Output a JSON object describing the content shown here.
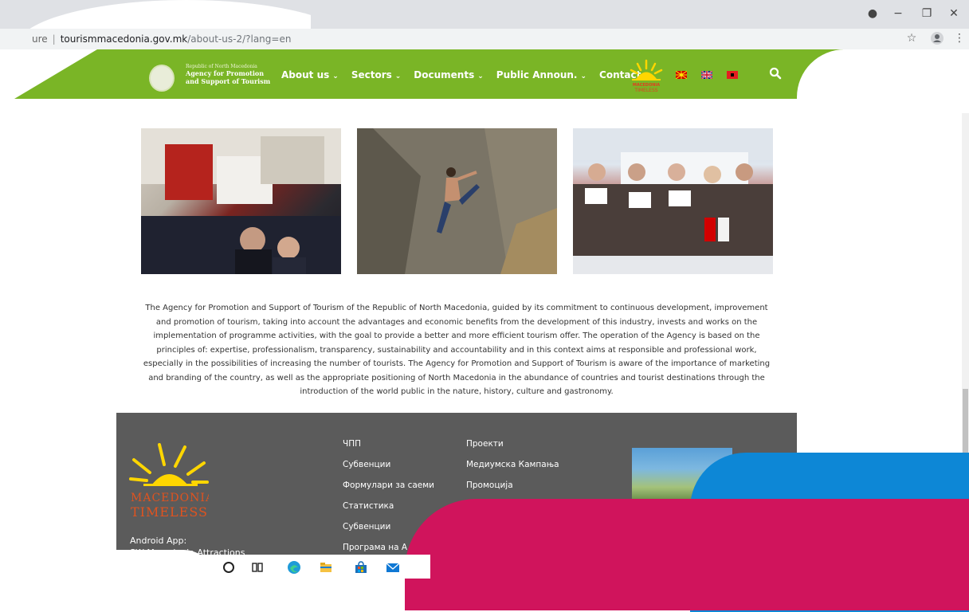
{
  "browser": {
    "url_prefix": "ure",
    "url_host": "tourismmacedonia.gov.mk",
    "url_path": "/about-us-2/?lang=en",
    "min_icon": "−",
    "restore_icon": "❐",
    "close_icon": "✕",
    "star_icon": "☆",
    "menu_icon": "⋮"
  },
  "brand": {
    "line1": "Republic of North Macedonia",
    "line2": "Agency for Promotion",
    "line3": "and Support of Tourism"
  },
  "nav": {
    "items": [
      {
        "label": "About us"
      },
      {
        "label": "Sectors"
      },
      {
        "label": "Documents"
      },
      {
        "label": "Public Announ."
      },
      {
        "label": "Contact"
      }
    ],
    "chevron": "⌄",
    "search_icon": "🔍",
    "logo_text": "MACEDONIA TIMELESS"
  },
  "intro_text": "The Agency for Promotion and Support of Tourism of the Republic of North Macedonia, guided by its commitment to continuous development, improvement and promotion of tourism, taking into account the advantages and economic benefits from the development of this industry, invests and works on the implementation of programme activities, with the goal to provide a better and more efficient tourism offer. The operation of the Agency is based on the principles of: expertise, professionalism, transparency, sustainability and accountability and in this context aims at responsible and professional work, especially in the possibilities of increasing the number of tourists. The Agency for Promotion and Support of Tourism is aware of the importance of marketing and branding of the country, as well as the appropriate positioning of North Macedonia in the abundance of countries and tourist destinations through the introduction of the world public in the nature, history, culture and gastronomy.",
  "footer": {
    "logo_line1": "MACEDONIA",
    "logo_line2": "TIMELESS",
    "android_label": "Android App:",
    "android_app": "SW Macedonia Attractions",
    "col1": [
      "ЧПП",
      "Субвенции",
      "Формулари за саеми",
      "Статистика",
      "Субвенции",
      "Програма на А"
    ],
    "col2": [
      "Проекти",
      "Медиумска Кампања",
      "Промоција"
    ]
  },
  "colors": {
    "nav_green": "#7ab526",
    "footer_gray": "#5b5b5b",
    "accent_blue": "#0d87d6",
    "accent_red": "#d0145c"
  }
}
